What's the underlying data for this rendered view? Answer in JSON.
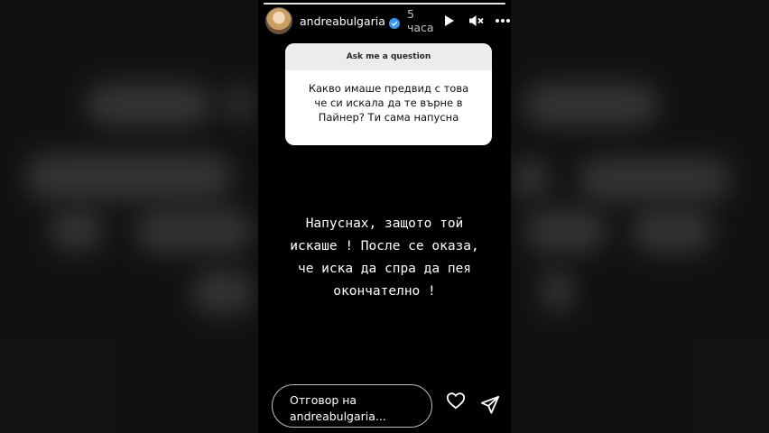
{
  "story": {
    "username": "andreabulgaria",
    "time": "5 часа",
    "icons": [
      "verified-icon",
      "play-icon",
      "mute-icon",
      "more-icon"
    ]
  },
  "question_sticker": {
    "title": "Ask me a question",
    "question": "Какво имаше предвид с това\nче си искала да те върне в\nПайнер? Ти сама напусна"
  },
  "answer_text": "Напуснах, защото той\nискаше ! После се оказа,\nче иска да спра да пея\nокончателно !",
  "footer": {
    "reply_placeholder": "Отговор на\nandreabulgaria...",
    "icons": [
      "heart-icon",
      "send-icon"
    ]
  },
  "colors": {
    "story_background": "#000000",
    "sticker_background": "#ffffff",
    "sticker_header": "#ececec",
    "verified_badge": "#3797f0"
  }
}
